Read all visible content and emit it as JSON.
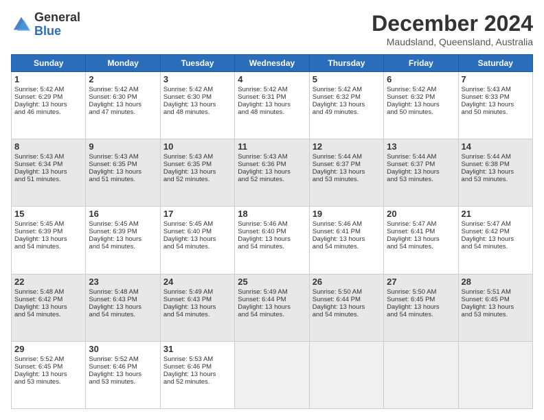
{
  "logo": {
    "general": "General",
    "blue": "Blue"
  },
  "title": "December 2024",
  "location": "Maudsland, Queensland, Australia",
  "days_of_week": [
    "Sunday",
    "Monday",
    "Tuesday",
    "Wednesday",
    "Thursday",
    "Friday",
    "Saturday"
  ],
  "weeks": [
    [
      {
        "day": 1,
        "sun": "5:42 AM",
        "set": "6:29 PM",
        "daylight": "13 hours and 46 minutes."
      },
      {
        "day": 2,
        "sun": "5:42 AM",
        "set": "6:30 PM",
        "daylight": "13 hours and 47 minutes."
      },
      {
        "day": 3,
        "sun": "5:42 AM",
        "set": "6:30 PM",
        "daylight": "13 hours and 48 minutes."
      },
      {
        "day": 4,
        "sun": "5:42 AM",
        "set": "6:31 PM",
        "daylight": "13 hours and 48 minutes."
      },
      {
        "day": 5,
        "sun": "5:42 AM",
        "set": "6:32 PM",
        "daylight": "13 hours and 49 minutes."
      },
      {
        "day": 6,
        "sun": "5:42 AM",
        "set": "6:32 PM",
        "daylight": "13 hours and 50 minutes."
      },
      {
        "day": 7,
        "sun": "5:43 AM",
        "set": "6:33 PM",
        "daylight": "13 hours and 50 minutes."
      }
    ],
    [
      {
        "day": 8,
        "sun": "5:43 AM",
        "set": "6:34 PM",
        "daylight": "13 hours and 51 minutes."
      },
      {
        "day": 9,
        "sun": "5:43 AM",
        "set": "6:35 PM",
        "daylight": "13 hours and 51 minutes."
      },
      {
        "day": 10,
        "sun": "5:43 AM",
        "set": "6:35 PM",
        "daylight": "13 hours and 52 minutes."
      },
      {
        "day": 11,
        "sun": "5:43 AM",
        "set": "6:36 PM",
        "daylight": "13 hours and 52 minutes."
      },
      {
        "day": 12,
        "sun": "5:44 AM",
        "set": "6:37 PM",
        "daylight": "13 hours and 53 minutes."
      },
      {
        "day": 13,
        "sun": "5:44 AM",
        "set": "6:37 PM",
        "daylight": "13 hours and 53 minutes."
      },
      {
        "day": 14,
        "sun": "5:44 AM",
        "set": "6:38 PM",
        "daylight": "13 hours and 53 minutes."
      }
    ],
    [
      {
        "day": 15,
        "sun": "5:45 AM",
        "set": "6:39 PM",
        "daylight": "13 hours and 54 minutes."
      },
      {
        "day": 16,
        "sun": "5:45 AM",
        "set": "6:39 PM",
        "daylight": "13 hours and 54 minutes."
      },
      {
        "day": 17,
        "sun": "5:45 AM",
        "set": "6:40 PM",
        "daylight": "13 hours and 54 minutes."
      },
      {
        "day": 18,
        "sun": "5:46 AM",
        "set": "6:40 PM",
        "daylight": "13 hours and 54 minutes."
      },
      {
        "day": 19,
        "sun": "5:46 AM",
        "set": "6:41 PM",
        "daylight": "13 hours and 54 minutes."
      },
      {
        "day": 20,
        "sun": "5:47 AM",
        "set": "6:41 PM",
        "daylight": "13 hours and 54 minutes."
      },
      {
        "day": 21,
        "sun": "5:47 AM",
        "set": "6:42 PM",
        "daylight": "13 hours and 54 minutes."
      }
    ],
    [
      {
        "day": 22,
        "sun": "5:48 AM",
        "set": "6:42 PM",
        "daylight": "13 hours and 54 minutes."
      },
      {
        "day": 23,
        "sun": "5:48 AM",
        "set": "6:43 PM",
        "daylight": "13 hours and 54 minutes."
      },
      {
        "day": 24,
        "sun": "5:49 AM",
        "set": "6:43 PM",
        "daylight": "13 hours and 54 minutes."
      },
      {
        "day": 25,
        "sun": "5:49 AM",
        "set": "6:44 PM",
        "daylight": "13 hours and 54 minutes."
      },
      {
        "day": 26,
        "sun": "5:50 AM",
        "set": "6:44 PM",
        "daylight": "13 hours and 54 minutes."
      },
      {
        "day": 27,
        "sun": "5:50 AM",
        "set": "6:45 PM",
        "daylight": "13 hours and 54 minutes."
      },
      {
        "day": 28,
        "sun": "5:51 AM",
        "set": "6:45 PM",
        "daylight": "13 hours and 53 minutes."
      }
    ],
    [
      {
        "day": 29,
        "sun": "5:52 AM",
        "set": "6:45 PM",
        "daylight": "13 hours and 53 minutes."
      },
      {
        "day": 30,
        "sun": "5:52 AM",
        "set": "6:46 PM",
        "daylight": "13 hours and 53 minutes."
      },
      {
        "day": 31,
        "sun": "5:53 AM",
        "set": "6:46 PM",
        "daylight": "13 hours and 52 minutes."
      },
      null,
      null,
      null,
      null
    ]
  ]
}
